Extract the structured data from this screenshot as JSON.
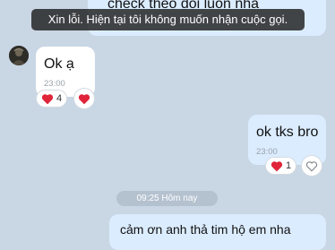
{
  "toast": {
    "text": "Xin lỗi. Hiện tại tôi không muốn nhận cuộc gọi."
  },
  "messages": [
    {
      "text": "check theo dõi luôn nha"
    },
    {
      "text": "Ok ạ",
      "time": "23:00",
      "reaction_count": "4"
    },
    {
      "text": "ok tks bro",
      "time": "23:00",
      "reaction_count": "1"
    },
    {
      "text": "cảm ơn anh thả tim hộ em nha"
    }
  ],
  "date_divider": "09:25 Hôm nay",
  "colors": {
    "heart": "#e0243a",
    "outgoing_bubble": "#dbecff",
    "incoming_bubble": "#ffffff",
    "background": "#c9d6e4"
  }
}
